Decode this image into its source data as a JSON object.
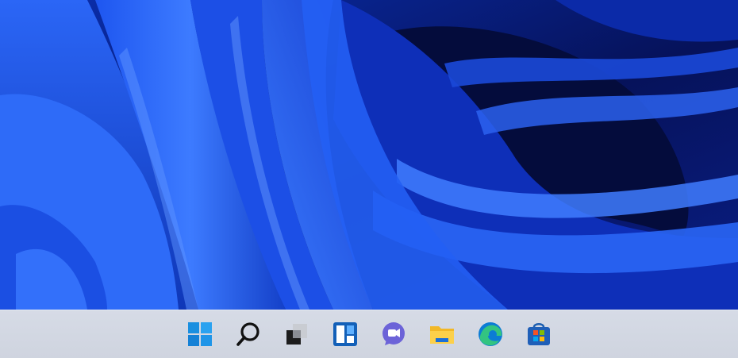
{
  "desktop": {
    "wallpaper": "windows-11-bloom",
    "colors": {
      "deep": "#061047",
      "mid": "#0f3fd8",
      "bright": "#2f6df7",
      "light": "#5f95ff"
    }
  },
  "taskbar": {
    "background": "#d3d8e2",
    "items": [
      {
        "name": "start",
        "icon": "windows-logo-icon"
      },
      {
        "name": "search",
        "icon": "search-icon"
      },
      {
        "name": "task-view",
        "icon": "task-view-icon"
      },
      {
        "name": "widgets",
        "icon": "widgets-icon"
      },
      {
        "name": "teams-chat",
        "icon": "chat-icon"
      },
      {
        "name": "file-explorer",
        "icon": "folder-icon"
      },
      {
        "name": "edge",
        "icon": "edge-icon"
      },
      {
        "name": "store",
        "icon": "store-icon"
      }
    ]
  }
}
